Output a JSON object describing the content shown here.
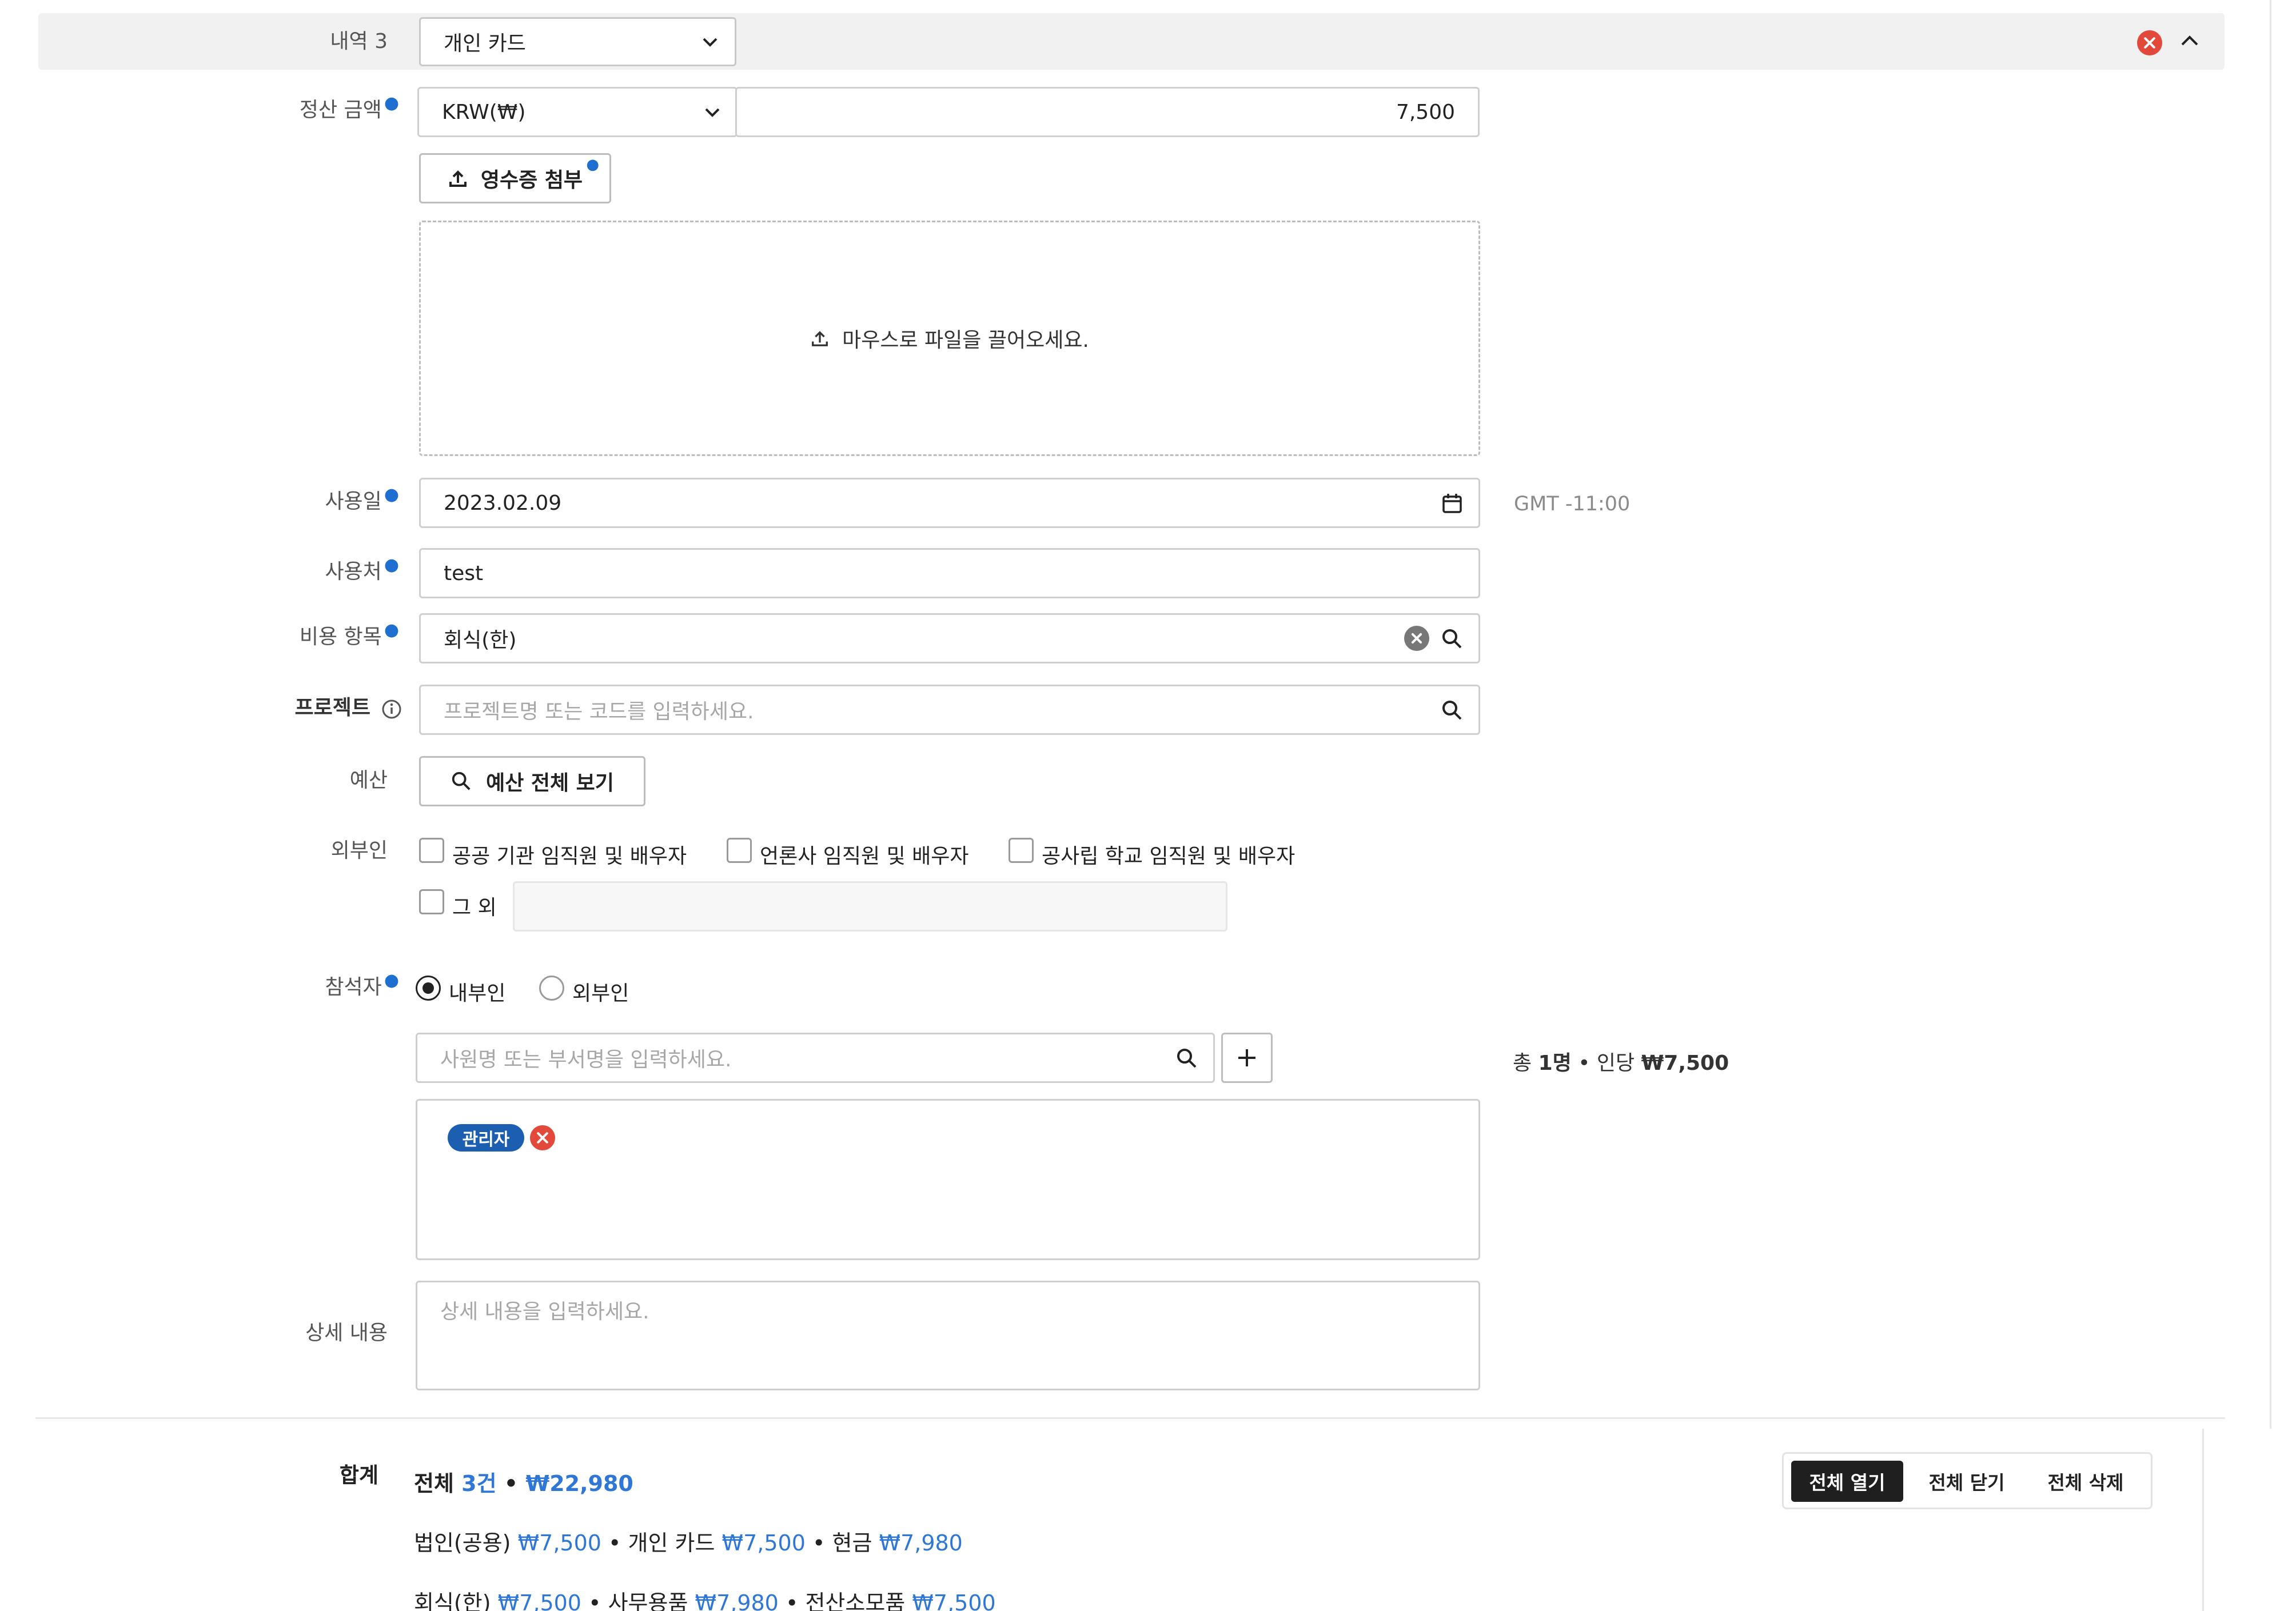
{
  "item_header": {
    "label": "내역 3",
    "payment_method": "개인 카드"
  },
  "amount": {
    "label": "정산 금액",
    "currency": "KRW(₩)",
    "value": "7,500"
  },
  "receipt": {
    "attach_label": "영수증 첨부",
    "drop_text": "마우스로 파일을 끌어오세요."
  },
  "use_date": {
    "label": "사용일",
    "value": "2023.02.09",
    "timezone": "GMT -11:00"
  },
  "merchant": {
    "label": "사용처",
    "value": "test"
  },
  "expense_item": {
    "label": "비용 항목",
    "value": "회식(한)"
  },
  "project": {
    "label": "프로젝트",
    "placeholder": "프로젝트명 또는 코드를 입력하세요."
  },
  "budget": {
    "label": "예산",
    "view_all_label": "예산 전체 보기"
  },
  "outsiders": {
    "label": "외부인",
    "options": [
      "공공 기관 임직원 및 배우자",
      "언론사 임직원 및 배우자",
      "공사립 학교 임직원 및 배우자",
      "그 외"
    ]
  },
  "attendees": {
    "label": "참석자",
    "radio_internal": "내부인",
    "radio_external": "외부인",
    "search_placeholder": "사원명 또는 부서명을 입력하세요.",
    "summary_prefix": "총 ",
    "summary_count": "1명",
    "summary_mid": " • 인당 ",
    "summary_amount": "₩7,500",
    "tags": [
      "관리자"
    ]
  },
  "details": {
    "label": "상세 내용",
    "placeholder": "상세 내용을 입력하세요."
  },
  "totals": {
    "label": "합계",
    "line1_prefix": "전체 ",
    "line1_count": "3건",
    "line1_sep": " • ",
    "line1_amount": "₩22,980",
    "line2": [
      {
        "name": "법인(공용)",
        "amount": "₩7,500"
      },
      {
        "name": "개인 카드",
        "amount": "₩7,500"
      },
      {
        "name": "현금",
        "amount": "₩7,980"
      }
    ],
    "line3": [
      {
        "name": "회식(한)",
        "amount": "₩7,500"
      },
      {
        "name": "사무용품",
        "amount": "₩7,980"
      },
      {
        "name": "전산소모품",
        "amount": "₩7,500"
      }
    ],
    "bullet": " • "
  },
  "actions": {
    "open_all": "전체 열기",
    "close_all": "전체 닫기",
    "delete_all": "전체 삭제"
  },
  "colors": {
    "accent_blue": "#2f77d6",
    "tag_blue": "#1c5fb0",
    "remove_red": "#e2493b"
  }
}
